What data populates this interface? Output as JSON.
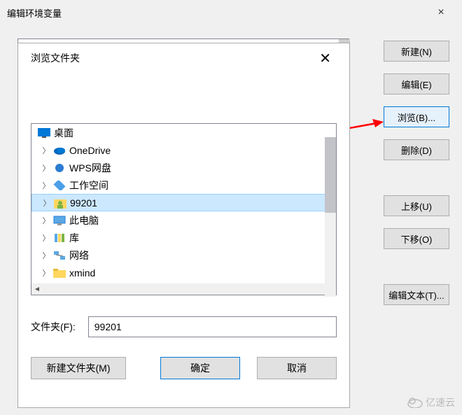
{
  "outer": {
    "title": "编辑环境变量",
    "close": "×",
    "buttons": {
      "new": "新建(N)",
      "edit": "编辑(E)",
      "browse": "浏览(B)...",
      "delete": "删除(D)",
      "moveup": "上移(U)",
      "movedown": "下移(O)",
      "edittext": "编辑文本(T)..."
    }
  },
  "inner": {
    "title": "浏览文件夹",
    "close": "✕",
    "tree": {
      "root": "桌面",
      "items": [
        "OneDrive",
        "WPS网盘",
        "工作空间",
        "99201",
        "此电脑",
        "库",
        "网络",
        "xmind"
      ],
      "selected_index": 3
    },
    "folder_label": "文件夹(F):",
    "folder_value": "99201",
    "buttons": {
      "newfolder": "新建文件夹(M)",
      "ok": "确定",
      "cancel": "取消"
    }
  },
  "watermark": "亿速云"
}
